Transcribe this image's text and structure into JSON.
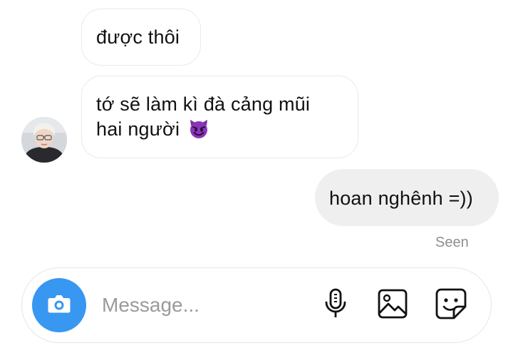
{
  "conversation": {
    "messages": [
      {
        "direction": "incoming",
        "lines": [
          "được thôi"
        ]
      },
      {
        "direction": "incoming",
        "lines": [
          "tớ sẽ làm kì đà cảng mũi",
          "hai người"
        ],
        "emoji": "smiling-imp-emoji"
      },
      {
        "direction": "outgoing",
        "lines": [
          "hoan nghênh =))"
        ]
      }
    ],
    "seen_label": "Seen"
  },
  "composer": {
    "placeholder": "Message...",
    "icons": [
      "camera-icon",
      "microphone-icon",
      "gallery-icon",
      "sticker-icon"
    ]
  },
  "colors": {
    "accent": "#3897f0",
    "outgoing_bubble": "#efefef",
    "incoming_border": "#e9e9e9",
    "seen_text": "#8e8e8e",
    "emoji_purple": "#7b2fa5"
  }
}
